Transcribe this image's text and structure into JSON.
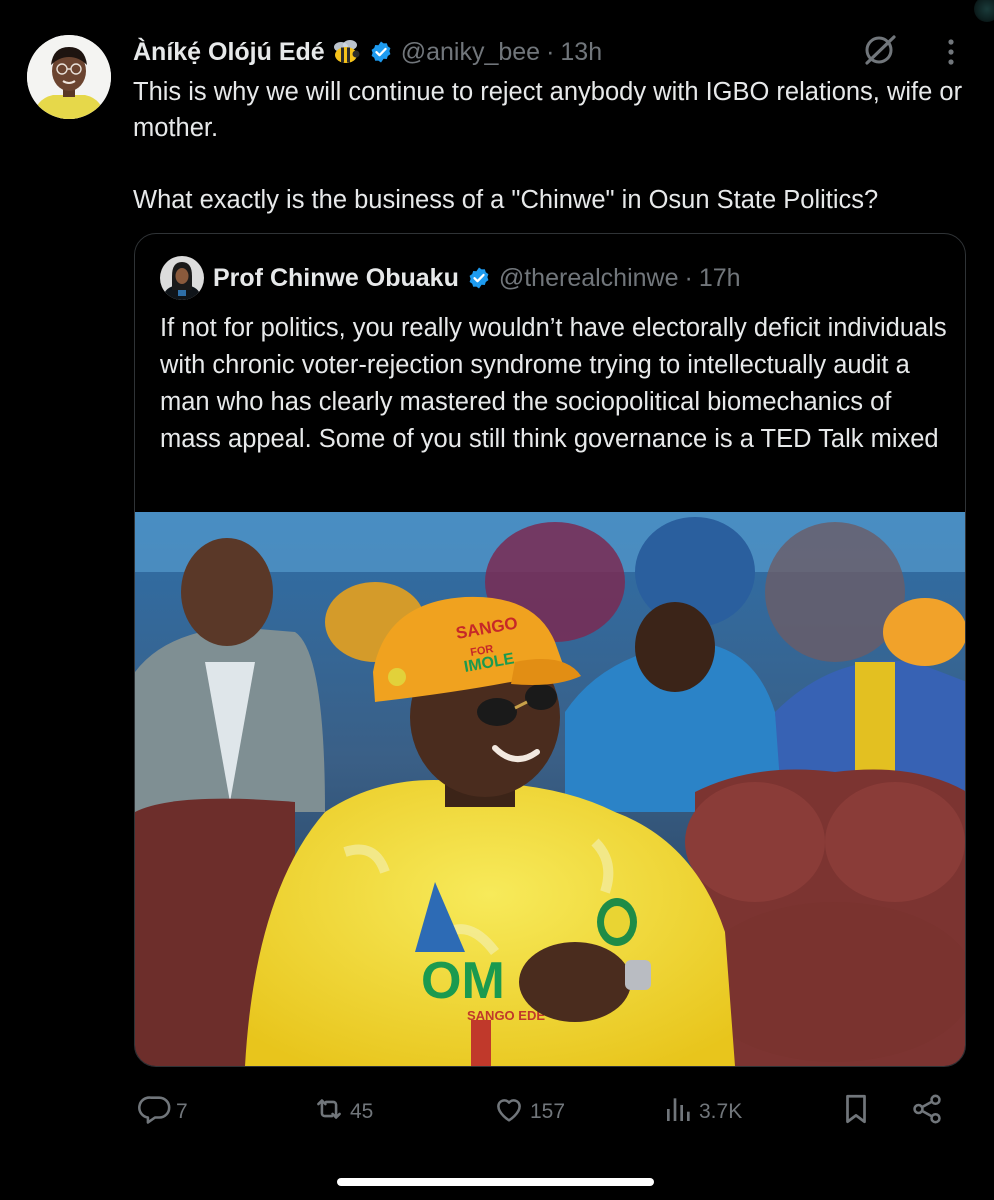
{
  "tweet": {
    "author": {
      "name": "Àníkẹ́ Olójú Edé",
      "emoji_icon": "bee-icon",
      "handle": "@aniky_bee",
      "separator": "·",
      "time": "13h",
      "verified_color": "#1d9bf0"
    },
    "text_paragraphs": [
      "This is why we will continue to reject anybody with IGBO relations, wife or mother.",
      "What exactly is the business of a \"Chinwe\" in Osun State Politics?"
    ],
    "quoted": {
      "author": {
        "name": "Prof Chinwe Obuaku",
        "handle": "@therealchinwe",
        "separator": "·",
        "time": "17h"
      },
      "text": "If not for politics, you really wouldn’t have electorally deficit individuals with chronic voter-rejection syndrome trying to intellectually audit a man who has clearly mastered the sociopolitical biomechanics of mass appeal. Some of you still think governance is a TED Talk mixed",
      "photo_texts": {
        "cap_line1": "SANGO",
        "cap_line2": "FOR",
        "cap_line3": "IMOLE",
        "shirt_logo": "OM",
        "shirt_sub": "SANGO EDE"
      }
    },
    "actions": {
      "replies": "7",
      "reposts": "45",
      "likes": "157",
      "views": "3.7K"
    }
  },
  "colors": {
    "background": "#000000",
    "text": "#e7e9ea",
    "muted": "#71767b",
    "border": "#2f3336",
    "accent": "#1d9bf0"
  }
}
